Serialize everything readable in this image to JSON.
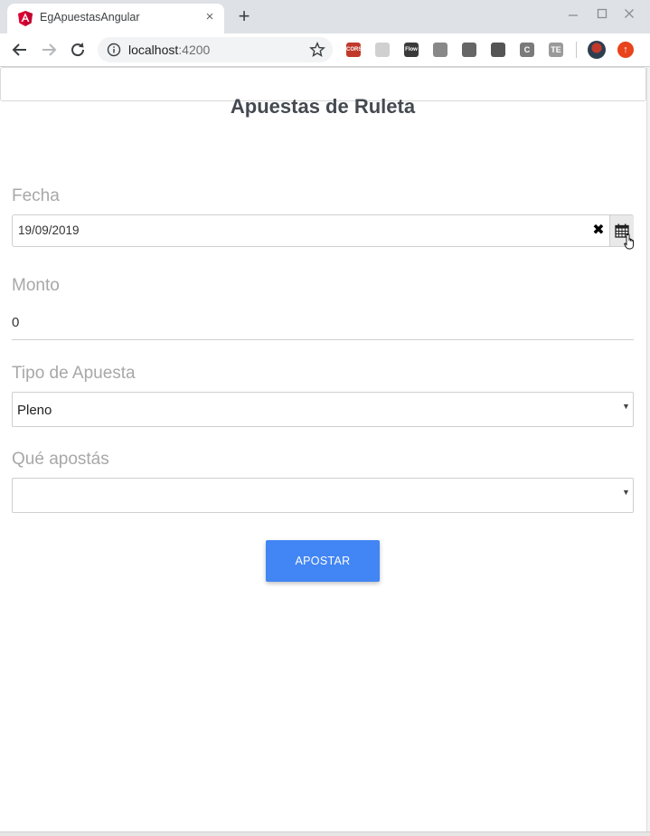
{
  "browser": {
    "tab_title": "EgApuestasAngular",
    "tab_close_glyph": "×",
    "new_tab_glyph": "+",
    "url_host": "localhost",
    "url_port": ":4200",
    "extensions": [
      {
        "name": "cors-extension",
        "label": "CORS",
        "color": "#c0392b"
      },
      {
        "name": "grid-extension",
        "label": "",
        "color": "#d0d0d0"
      },
      {
        "name": "flow-extension",
        "label": "Flow",
        "color": "#3a3a3a"
      },
      {
        "name": "vue-devtools-extension",
        "label": "",
        "color": "#888888"
      },
      {
        "name": "cube-extension",
        "label": "",
        "color": "#666666"
      },
      {
        "name": "hash-extension",
        "label": "",
        "color": "#555555"
      },
      {
        "name": "c-extension",
        "label": "C",
        "color": "#7a7a7a"
      },
      {
        "name": "te-extension",
        "label": "TE",
        "color": "#9a9a9a"
      }
    ],
    "colors": {
      "tabstrip": "#dee1e6",
      "toolbar": "#ffffff"
    }
  },
  "page": {
    "title": "Apuestas de Ruleta",
    "fecha": {
      "label": "Fecha",
      "value": "19/09/2019",
      "clear_glyph": "✖"
    },
    "monto": {
      "label": "Monto",
      "value": "0"
    },
    "tipo_apuesta": {
      "label": "Tipo de Apuesta",
      "selected": "Pleno",
      "arrow": "▼"
    },
    "que_apostas": {
      "label": "Qué apostás",
      "selected": "",
      "arrow": "▼"
    },
    "submit_label": "APOSTAR",
    "colors": {
      "accent": "#4285f4",
      "label": "#a8a8a8",
      "title": "#454a51"
    }
  }
}
